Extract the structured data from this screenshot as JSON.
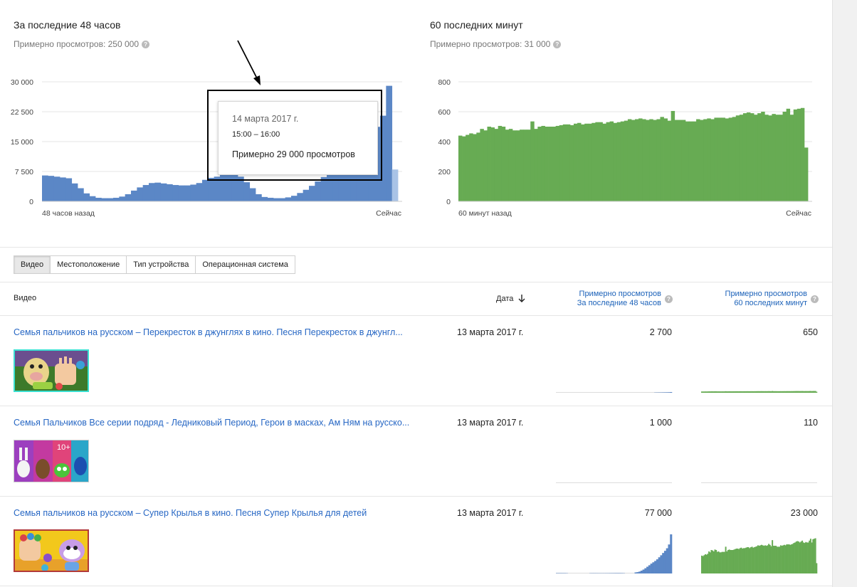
{
  "panel48": {
    "title": "За последние 48 часов",
    "subtitle": "Примерно просмотров: 250 000",
    "help": "?",
    "y_ticks": [
      "30 000",
      "22 500",
      "15 000",
      "7 500",
      "0"
    ],
    "x_start": "48 часов назад",
    "x_end": "Сейчас",
    "color": "#5b87c6",
    "highlight_color": "#a9c3e6"
  },
  "panel60": {
    "title": "60 последних минут",
    "subtitle": "Примерно просмотров: 31 000",
    "help": "?",
    "y_ticks": [
      "800",
      "600",
      "400",
      "200",
      "0"
    ],
    "x_start": "60 минут назад",
    "x_end": "Сейчас",
    "color": "#67ab53"
  },
  "tooltip": {
    "date": "14 марта 2017 г.",
    "time": "15:00 – 16:00",
    "views": "Примерно 29 000 просмотров"
  },
  "tabs": [
    {
      "label": "Видео",
      "active": true
    },
    {
      "label": "Местоположение",
      "active": false
    },
    {
      "label": "Тип устройства",
      "active": false
    },
    {
      "label": "Операционная система",
      "active": false
    }
  ],
  "table": {
    "col_video": "Видео",
    "col_date": "Дата",
    "col_48_line1": "Примерно просмотров",
    "col_48_line2": "За последние 48 часов",
    "col_60_line1": "Примерно просмотров",
    "col_60_line2": "60 последних минут",
    "rows": [
      {
        "title": "Семья пальчиков на русском – Перекресток в джунглях в кино. Песня Перекресток в джунгл...",
        "date": "13 марта 2017 г.",
        "views48": "2 700",
        "views60": "650"
      },
      {
        "title": "Семья Пальчиков Все серии подряд - Ледниковый Период, Герои в масках, Ам Ням на русско...",
        "date": "13 марта 2017 г.",
        "views48": "1 000",
        "views60": "110"
      },
      {
        "title": "Семья пальчиков на русском – Супер Крылья в кино. Песня Супер Крылья для детей",
        "date": "13 марта 2017 г.",
        "views48": "77 000",
        "views60": "23 000"
      }
    ]
  },
  "chart_data": [
    {
      "type": "bar",
      "title": "За последние 48 часов",
      "ylim": [
        0,
        30000
      ],
      "x_range": [
        "48 часов назад",
        "Сейчас"
      ],
      "grid": true,
      "values": [
        6500,
        6400,
        6200,
        6000,
        5800,
        4500,
        3300,
        2000,
        1300,
        900,
        800,
        800,
        900,
        1200,
        1800,
        2700,
        3500,
        4100,
        4600,
        4700,
        4500,
        4300,
        4100,
        4000,
        4000,
        4200,
        4600,
        5400,
        5900,
        6200,
        6700,
        7000,
        6800,
        6200,
        4800,
        3300,
        1800,
        1100,
        900,
        800,
        800,
        1000,
        1400,
        2100,
        2900,
        3900,
        5000,
        6100,
        7300,
        8300,
        9300,
        10500,
        12000,
        13500,
        15200,
        16800,
        18700,
        21500,
        29000,
        8000
      ],
      "highlighted_last": true
    },
    {
      "type": "bar",
      "title": "60 последних минут",
      "ylim": [
        0,
        800
      ],
      "x_range": [
        "60 минут назад",
        "Сейчас"
      ],
      "grid": true,
      "values": [
        440,
        435,
        445,
        455,
        450,
        460,
        485,
        475,
        500,
        495,
        485,
        505,
        500,
        480,
        485,
        475,
        475,
        480,
        480,
        480,
        535,
        485,
        500,
        505,
        500,
        500,
        500,
        505,
        510,
        515,
        515,
        510,
        520,
        525,
        515,
        520,
        520,
        525,
        530,
        530,
        520,
        530,
        535,
        525,
        530,
        535,
        540,
        550,
        545,
        550,
        555,
        550,
        545,
        550,
        545,
        550,
        565,
        555,
        540,
        605,
        545,
        545,
        545,
        535,
        535,
        535,
        550,
        545,
        550,
        555,
        550,
        560,
        560,
        560,
        555,
        560,
        565,
        575,
        580,
        590,
        595,
        590,
        580,
        590,
        600,
        580,
        575,
        585,
        580,
        580,
        600,
        620,
        580,
        615,
        620,
        625,
        360
      ]
    }
  ]
}
